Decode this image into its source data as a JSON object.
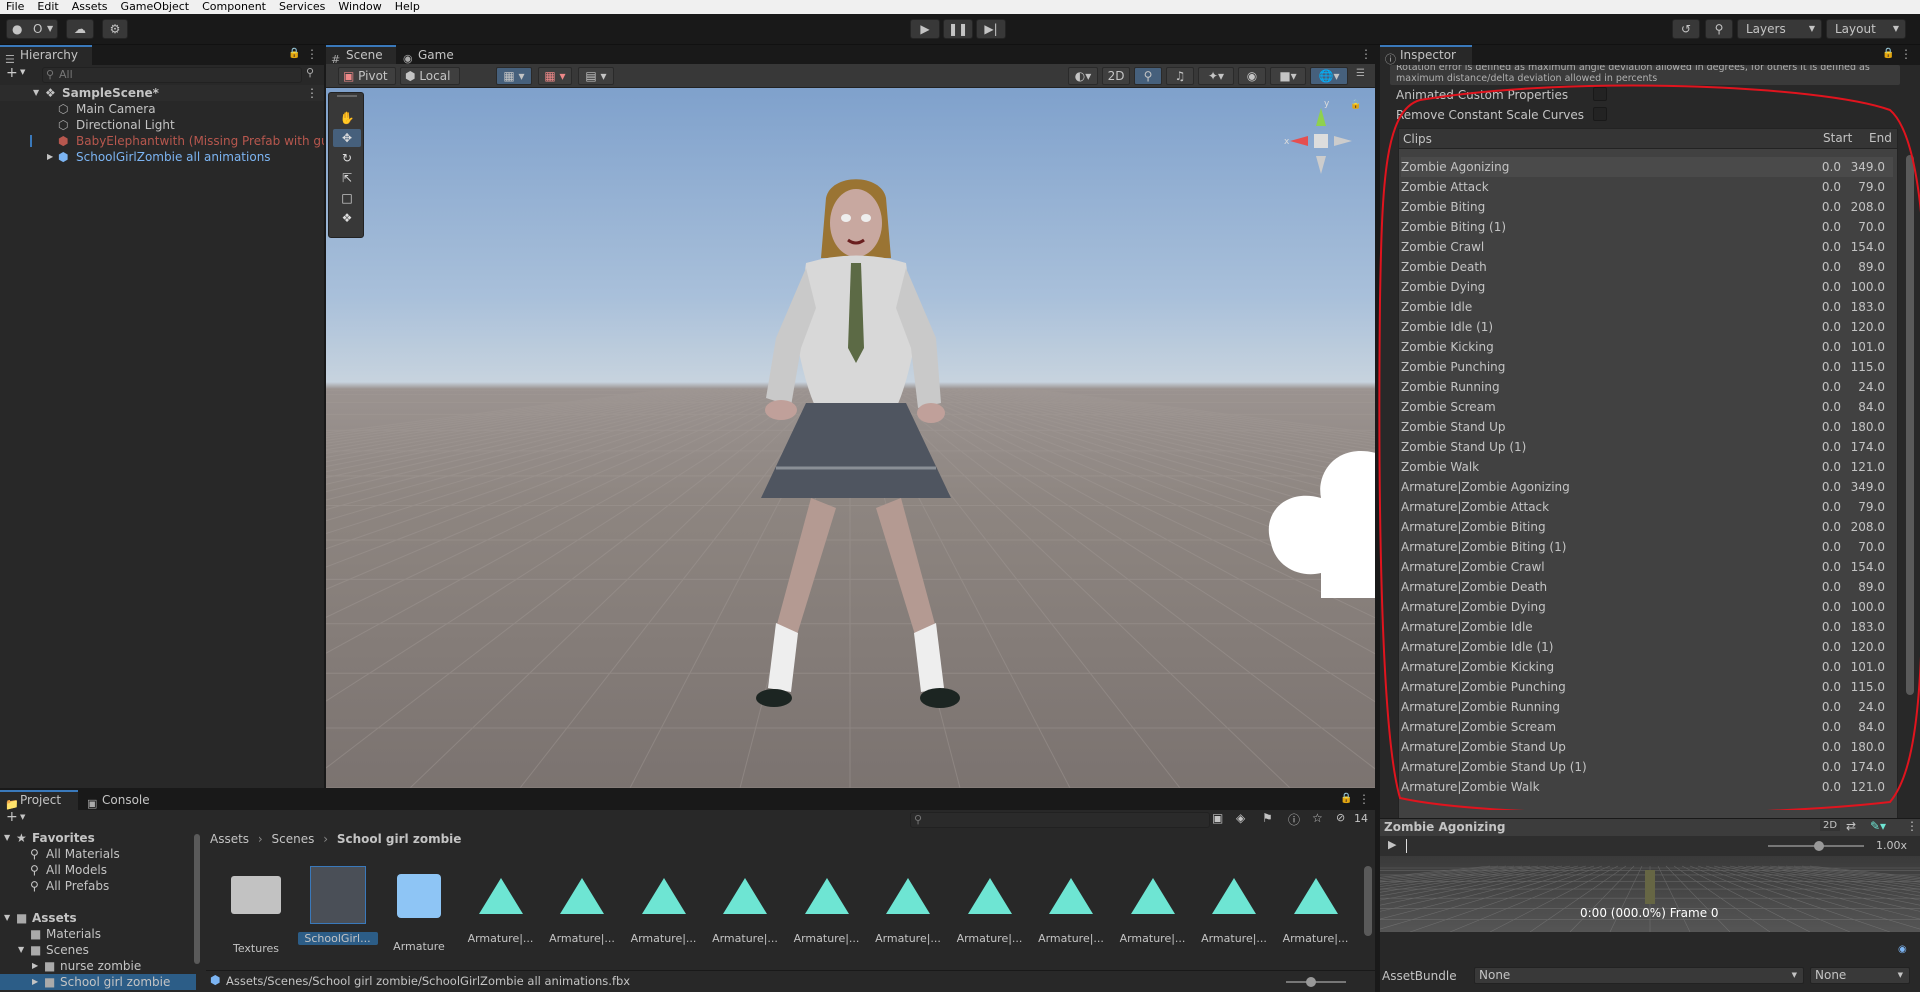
{
  "menu": [
    "File",
    "Edit",
    "Assets",
    "GameObject",
    "Component",
    "Services",
    "Window",
    "Help"
  ],
  "toolbar": {
    "account_label": "O",
    "layers_label": "Layers",
    "layout_label": "Layout"
  },
  "hierarchy": {
    "tab_label": "Hierarchy",
    "search_placeholder": "All",
    "items": [
      {
        "label": "SampleScene*"
      },
      {
        "label": "Main Camera"
      },
      {
        "label": "Directional Light"
      },
      {
        "label": "BabyElephantwith (Missing Prefab with guid"
      },
      {
        "label": "SchoolGirlZombie all animations"
      }
    ]
  },
  "scene": {
    "tabs": [
      {
        "label": "Scene"
      },
      {
        "label": "Game"
      }
    ],
    "pivot_label": "Pivot",
    "local_label": "Local",
    "mode_2d_label": "2D"
  },
  "inspector": {
    "tab_label": "Inspector",
    "note_line1": "Rotation error is defined as maximum angle deviation allowed in degrees, for others it is defined as",
    "note_line2": "maximum distance/delta deviation allowed in percents",
    "animated_custom_label": "Animated Custom Properties",
    "remove_scale_label": "Remove Constant Scale Curves",
    "clips_header": "Clips",
    "start_header": "Start",
    "end_header": "End",
    "clips": [
      {
        "name": "Zombie Agonizing",
        "start": "0.0",
        "end": "349.0"
      },
      {
        "name": "Zombie Attack",
        "start": "0.0",
        "end": "79.0"
      },
      {
        "name": "Zombie Biting",
        "start": "0.0",
        "end": "208.0"
      },
      {
        "name": "Zombie Biting (1)",
        "start": "0.0",
        "end": "70.0"
      },
      {
        "name": "Zombie Crawl",
        "start": "0.0",
        "end": "154.0"
      },
      {
        "name": "Zombie Death",
        "start": "0.0",
        "end": "89.0"
      },
      {
        "name": "Zombie Dying",
        "start": "0.0",
        "end": "100.0"
      },
      {
        "name": "Zombie Idle",
        "start": "0.0",
        "end": "183.0"
      },
      {
        "name": "Zombie Idle (1)",
        "start": "0.0",
        "end": "120.0"
      },
      {
        "name": "Zombie Kicking",
        "start": "0.0",
        "end": "101.0"
      },
      {
        "name": "Zombie Punching",
        "start": "0.0",
        "end": "115.0"
      },
      {
        "name": "Zombie Running",
        "start": "0.0",
        "end": "24.0"
      },
      {
        "name": "Zombie Scream",
        "start": "0.0",
        "end": "84.0"
      },
      {
        "name": "Zombie Stand Up",
        "start": "0.0",
        "end": "180.0"
      },
      {
        "name": "Zombie Stand Up (1)",
        "start": "0.0",
        "end": "174.0"
      },
      {
        "name": "Zombie Walk",
        "start": "0.0",
        "end": "121.0"
      },
      {
        "name": "Armature|Zombie Agonizing",
        "start": "0.0",
        "end": "349.0"
      },
      {
        "name": "Armature|Zombie Attack",
        "start": "0.0",
        "end": "79.0"
      },
      {
        "name": "Armature|Zombie Biting",
        "start": "0.0",
        "end": "208.0"
      },
      {
        "name": "Armature|Zombie Biting (1)",
        "start": "0.0",
        "end": "70.0"
      },
      {
        "name": "Armature|Zombie Crawl",
        "start": "0.0",
        "end": "154.0"
      },
      {
        "name": "Armature|Zombie Death",
        "start": "0.0",
        "end": "89.0"
      },
      {
        "name": "Armature|Zombie Dying",
        "start": "0.0",
        "end": "100.0"
      },
      {
        "name": "Armature|Zombie Idle",
        "start": "0.0",
        "end": "183.0"
      },
      {
        "name": "Armature|Zombie Idle (1)",
        "start": "0.0",
        "end": "120.0"
      },
      {
        "name": "Armature|Zombie Kicking",
        "start": "0.0",
        "end": "101.0"
      },
      {
        "name": "Armature|Zombie Punching",
        "start": "0.0",
        "end": "115.0"
      },
      {
        "name": "Armature|Zombie Running",
        "start": "0.0",
        "end": "24.0"
      },
      {
        "name": "Armature|Zombie Scream",
        "start": "0.0",
        "end": "84.0"
      },
      {
        "name": "Armature|Zombie Stand Up",
        "start": "0.0",
        "end": "180.0"
      },
      {
        "name": "Armature|Zombie Stand Up (1)",
        "start": "0.0",
        "end": "174.0"
      },
      {
        "name": "Armature|Zombie Walk",
        "start": "0.0",
        "end": "121.0"
      }
    ],
    "preview": {
      "title": "Zombie Agonizing",
      "mode_label": "2D",
      "speed_label": "1.00x",
      "time_label": "0:00 (000.0%) Frame 0"
    },
    "assetbundle_label": "AssetBundle",
    "assetbundle_value": "None",
    "variant_value": "None"
  },
  "project": {
    "tabs": [
      {
        "label": "Project"
      },
      {
        "label": "Console"
      }
    ],
    "hidden_count": "14",
    "breadcrumb": [
      "Assets",
      "Scenes",
      "School girl zombie"
    ],
    "tree": [
      {
        "label": "Favorites"
      },
      {
        "label": "All Materials"
      },
      {
        "label": "All Models"
      },
      {
        "label": "All Prefabs"
      },
      {
        "label": "Assets"
      },
      {
        "label": "Materials"
      },
      {
        "label": "Scenes"
      },
      {
        "label": "nurse zombie"
      },
      {
        "label": "School girl zombie"
      }
    ],
    "items": [
      {
        "label": "Textures"
      },
      {
        "label": "SchoolGirl..."
      },
      {
        "label": "Armature"
      },
      {
        "label": "Armature|..."
      },
      {
        "label": "Armature|..."
      },
      {
        "label": "Armature|..."
      },
      {
        "label": "Armature|..."
      },
      {
        "label": "Armature|..."
      },
      {
        "label": "Armature|..."
      },
      {
        "label": "Armature|..."
      },
      {
        "label": "Armature|..."
      },
      {
        "label": "Armature|..."
      },
      {
        "label": "Armature|..."
      },
      {
        "label": "Armature|..."
      }
    ],
    "path": "Assets/Scenes/School girl zombie/SchoolGirlZombie all animations.fbx"
  },
  "colors": {
    "accent": "#3a79bb",
    "highlight_circle": "#e0141e",
    "prefab_blue": "#7cb4f2",
    "missing_red": "#b7574e",
    "anim_clip": "#6ee5d3"
  }
}
